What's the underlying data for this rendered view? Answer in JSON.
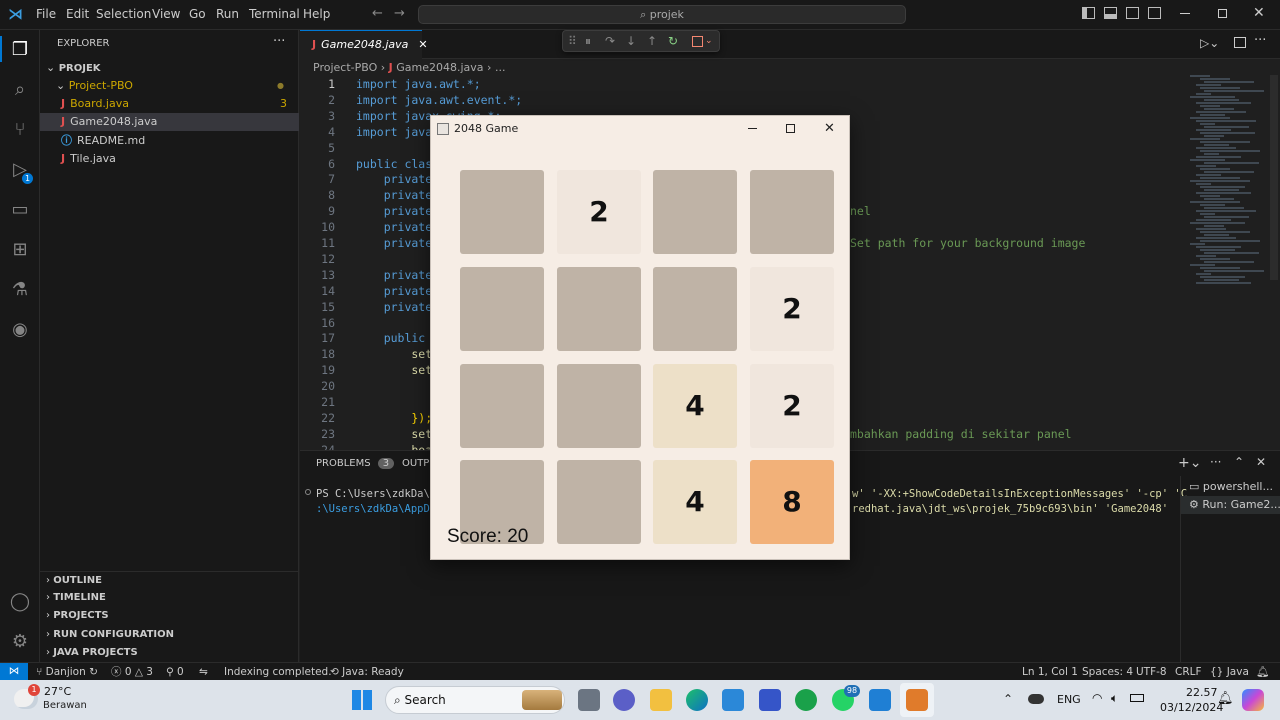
{
  "titlebar": {
    "menus": [
      "File",
      "Edit",
      "Selection",
      "View",
      "Go",
      "Run",
      "Terminal",
      "Help"
    ],
    "search": "projek"
  },
  "sidebar": {
    "title": "EXPLORER",
    "root": "PROJEK",
    "folder": "Project-PBO",
    "files": [
      {
        "name": "Board.java",
        "badge": "3",
        "color": "#cca700",
        "icon": "J"
      },
      {
        "name": "Game2048.java",
        "badge": "",
        "color": "#cccccc",
        "icon": "J"
      },
      {
        "name": "README.md",
        "badge": "",
        "color": "#cccccc",
        "icon": "ⓘ"
      },
      {
        "name": "Tile.java",
        "badge": "",
        "color": "#cccccc",
        "icon": "J"
      }
    ],
    "sections": [
      "OUTLINE",
      "TIMELINE",
      "PROJECTS",
      "RUN CONFIGURATION",
      "JAVA PROJECTS"
    ]
  },
  "editor": {
    "tab": "Game2048.java",
    "breadcrumb": [
      "Project-PBO",
      "Game2048.java",
      "..."
    ],
    "lines": [
      {
        "n": "1",
        "code": "import java.awt.*;"
      },
      {
        "n": "2",
        "code": "import java.awt.event.*;"
      },
      {
        "n": "3",
        "code": "import javax.swing.*;"
      },
      {
        "n": "4",
        "code": "import javax."
      },
      {
        "n": "5",
        "code": ""
      },
      {
        "n": "6",
        "code": "public class"
      },
      {
        "n": "7",
        "code": "    private"
      },
      {
        "n": "8",
        "code": "    private"
      },
      {
        "n": "9",
        "code": "    private"
      },
      {
        "n": "10",
        "code": "    private"
      },
      {
        "n": "11",
        "code": "    private"
      },
      {
        "n": "12",
        "code": ""
      },
      {
        "n": "13",
        "code": "    private"
      },
      {
        "n": "14",
        "code": "    private"
      },
      {
        "n": "15",
        "code": "    private"
      },
      {
        "n": "16",
        "code": ""
      },
      {
        "n": "17",
        "code": "    public G"
      },
      {
        "n": "18",
        "code": "        setR"
      },
      {
        "n": "19",
        "code": "        setR"
      },
      {
        "n": "20",
        "code": ""
      },
      {
        "n": "21",
        "code": ""
      },
      {
        "n": "22",
        "code": "        });"
      },
      {
        "n": "23",
        "code": "        setL"
      },
      {
        "n": "24",
        "code": "        boar"
      }
    ],
    "comments": [
      {
        "line": 9,
        "text": "nel"
      },
      {
        "line": 11,
        "text": "Set path for your background image"
      },
      {
        "line": 23,
        "text": "mbahkan padding di sekitar panel"
      }
    ]
  },
  "panel": {
    "tabs": [
      "PROBLEMS",
      "OUTPUT"
    ],
    "problems_count": "3",
    "terminal_lines": [
      "PS C:\\Users\\zdkDa\\p",
      ":\\Users\\zdkDa\\AppDa"
    ],
    "terminal_tail": [
      "w' '-XX:+ShowCodeDetailsInExceptionMessages' '-cp' 'C",
      "redhat.java\\jdt_ws\\projek_75b9c693\\bin' 'Game2048'"
    ],
    "terminals": [
      "powershell...",
      "Run: Game2..."
    ]
  },
  "statusbar": {
    "branch": "Danjion",
    "errors": "0",
    "warnings": "3",
    "ports": "0",
    "indexing": "Indexing completed.",
    "java": "Java: Ready",
    "position": "Ln 1, Col 1",
    "spaces": "Spaces: 4",
    "encoding": "UTF-8",
    "eol": "CRLF",
    "language": "Java"
  },
  "game": {
    "title": "2048 Game",
    "score_label": "Score: 20",
    "tiles": [
      [
        "",
        "2",
        "",
        ""
      ],
      [
        "",
        "",
        "",
        "2"
      ],
      [
        "",
        "",
        "4",
        "2"
      ],
      [
        "",
        "",
        "4",
        "8"
      ]
    ],
    "colors": {
      "empty": "#bfb3a6",
      "2": "#f0e6dd",
      "4": "#ede0c8",
      "8": "#f2b179"
    }
  },
  "taskbar": {
    "weather_temp": "27°C",
    "weather_desc": "Berawan",
    "weather_badge": "1",
    "search": "Search",
    "whatsapp_badge": "98",
    "lang": "ENG",
    "time": "22.57",
    "date": "03/12/2024"
  }
}
